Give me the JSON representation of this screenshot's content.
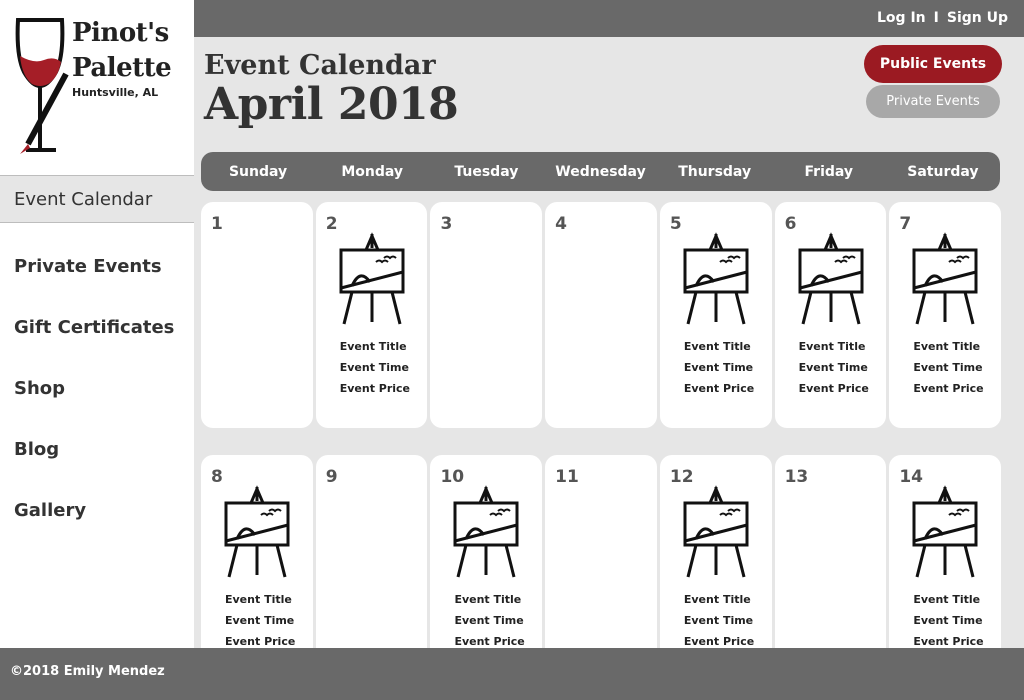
{
  "brand": {
    "name_line1": "Pinot's",
    "name_line2": "Palette",
    "location": "Huntsville, AL"
  },
  "nav": [
    {
      "label": "Event Calendar"
    },
    {
      "label": "Private Events"
    },
    {
      "label": "Gift Certificates"
    },
    {
      "label": "Shop"
    },
    {
      "label": "Blog"
    },
    {
      "label": "Gallery"
    }
  ],
  "auth": {
    "login": "Log In",
    "separator": "I",
    "signup": "Sign Up"
  },
  "header": {
    "subtitle": "Event Calendar",
    "title": "April 2018"
  },
  "buttons": {
    "public": "Public Events",
    "private": "Private Events"
  },
  "weekdays": [
    "Sunday",
    "Monday",
    "Tuesday",
    "Wednesday",
    "Thursday",
    "Friday",
    "Saturday"
  ],
  "event_labels": {
    "title": "Event Title",
    "time": "Event Time",
    "price": "Event Price"
  },
  "calendar": [
    [
      {
        "day": "1",
        "event": false
      },
      {
        "day": "2",
        "event": true
      },
      {
        "day": "3",
        "event": false
      },
      {
        "day": "4",
        "event": false
      },
      {
        "day": "5",
        "event": true
      },
      {
        "day": "6",
        "event": true
      },
      {
        "day": "7",
        "event": true
      }
    ],
    [
      {
        "day": "8",
        "event": true
      },
      {
        "day": "9",
        "event": false
      },
      {
        "day": "10",
        "event": true
      },
      {
        "day": "11",
        "event": false
      },
      {
        "day": "12",
        "event": true
      },
      {
        "day": "13",
        "event": false
      },
      {
        "day": "14",
        "event": true
      }
    ]
  ],
  "footer": {
    "copyright": "©2018 Emily Mendez"
  },
  "colors": {
    "accent": "#9b1a22",
    "bar": "#696969",
    "background": "#e6e6e6"
  },
  "icons": {
    "logo": "wine-glass-brush-icon",
    "event": "easel-icon"
  }
}
